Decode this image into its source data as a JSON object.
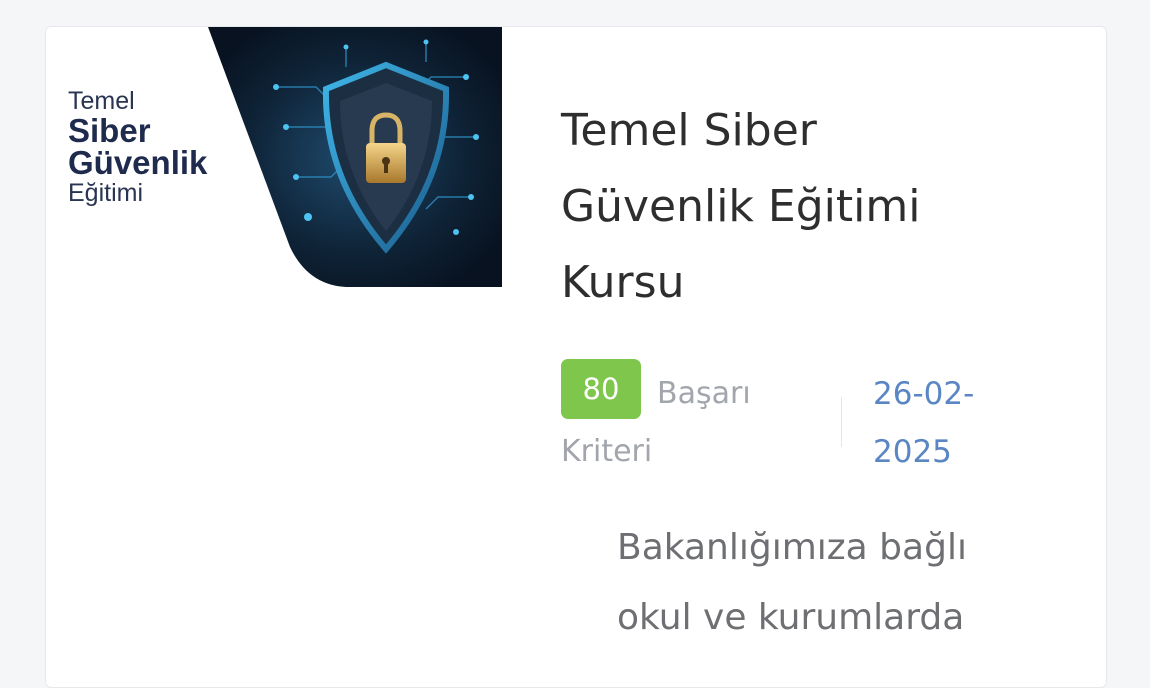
{
  "course": {
    "thumbnail": {
      "line1": "Temel",
      "line2": "Siber",
      "line3": "Güvenlik",
      "line4": "Eğitimi",
      "icon": "shield-lock-icon"
    },
    "title": "Temel Siber Güvenlik Eğitimi Kursu",
    "score": "80",
    "criteria_label": "Başarı Kriteri",
    "date": "26-02-2025",
    "description": "Bakanlığımıza bağlı okul ve kurumlarda"
  },
  "colors": {
    "badge": "#7fc64c",
    "date": "#5b86c4",
    "thumbnail_dark": "#0d1a2a"
  }
}
